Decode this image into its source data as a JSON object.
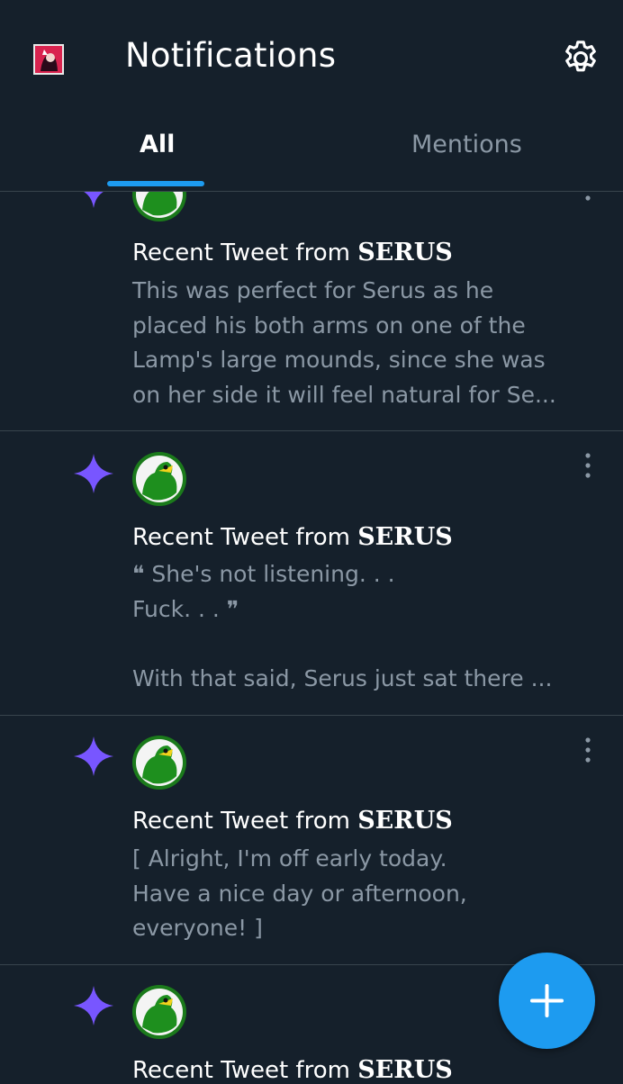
{
  "header": {
    "title": "Notifications",
    "tabs": [
      {
        "label": "All",
        "active": true
      },
      {
        "label": "Mentions",
        "active": false
      }
    ]
  },
  "notifications": [
    {
      "prefix": "Recent Tweet from ",
      "author": "SERUS",
      "text": "This was perfect for Serus as he\nplaced his both arms on one of the\nLamp's large mounds, since she was\non her side it will feel natural for Se..."
    },
    {
      "prefix": "Recent Tweet from ",
      "author": "SERUS",
      "text": "❝ She's not listening. . .\nFuck. . . ❞\n\nWith that said, Serus just sat there ..."
    },
    {
      "prefix": "Recent Tweet from ",
      "author": "SERUS",
      "text": "[ Alright, I'm off early today.\nHave a nice day or afternoon,\neveryone! ]"
    },
    {
      "prefix": "Recent Tweet from ",
      "author": "SERUS",
      "text": ""
    }
  ],
  "icons": {
    "notification_type": "sparkle-star-icon",
    "overflow": "more-vertical-icon",
    "settings": "gear-icon",
    "compose": "plus-icon"
  },
  "colors": {
    "background": "#15202b",
    "accent": "#1d9bf0",
    "star": "#7856ff",
    "secondary_text": "#8b98a5",
    "divider": "#38444d"
  }
}
